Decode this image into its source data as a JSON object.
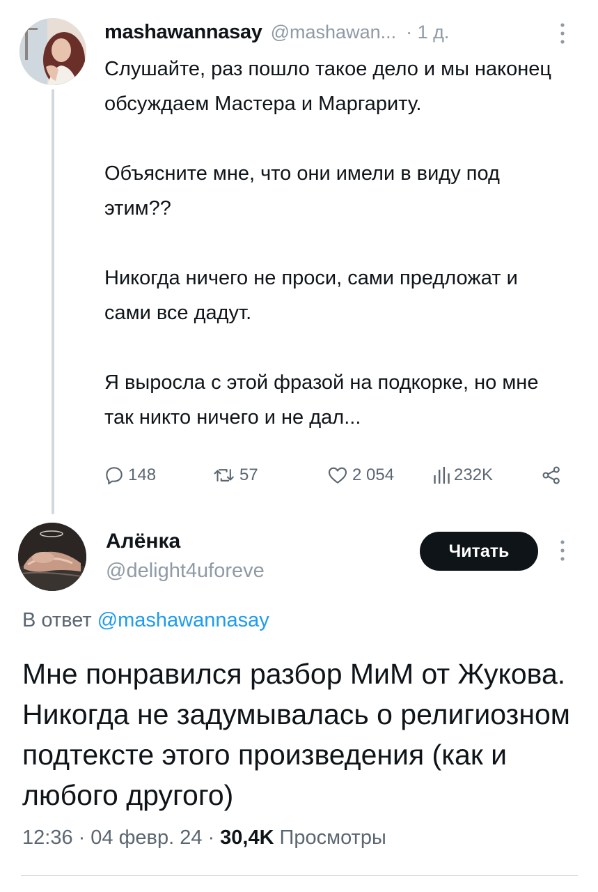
{
  "parent_tweet": {
    "author_name": "mashawannasay",
    "author_handle": "@mashawan...",
    "time": "· 1 д.",
    "paragraphs": [
      "Слушайте, раз пошло такое дело и мы наконец обсуждаем Мастера и Маргариту.",
      "Объясните мне, что они имели в виду под этим??",
      "Никогда ничего не проси, сами предложат и сами все дадут.",
      "Я выросла с этой фразой на подкорке, но мне так никто ничего и не дал..."
    ],
    "actions": {
      "replies": "148",
      "retweets": "57",
      "likes": "2 054",
      "views": "232K"
    }
  },
  "reply_tweet": {
    "author_name": "Алёнка",
    "author_handle": "@delight4uforeve",
    "follow_label": "Читать",
    "reply_prefix": "В ответ",
    "reply_mention": "@mashawannasay",
    "text": "Мне понравился разбор МиМ от Жукова. Никогда не задумывалась о религиозном подтексте этого произведения (как и любого другого)",
    "time": "12:36",
    "date": "04 февр. 24",
    "views_count": "30,4K",
    "views_label": "Просмотры"
  },
  "icons": {
    "more": "more-vertical-icon",
    "reply": "reply-icon",
    "retweet": "retweet-icon",
    "like": "heart-icon",
    "views": "views-chart-icon",
    "share": "share-icon"
  },
  "colors": {
    "text_primary": "#0f1419",
    "text_secondary": "#5b6670",
    "accent": "#1d9bf0",
    "thread_line": "#cfd9de",
    "button_bg": "#0f1419"
  }
}
